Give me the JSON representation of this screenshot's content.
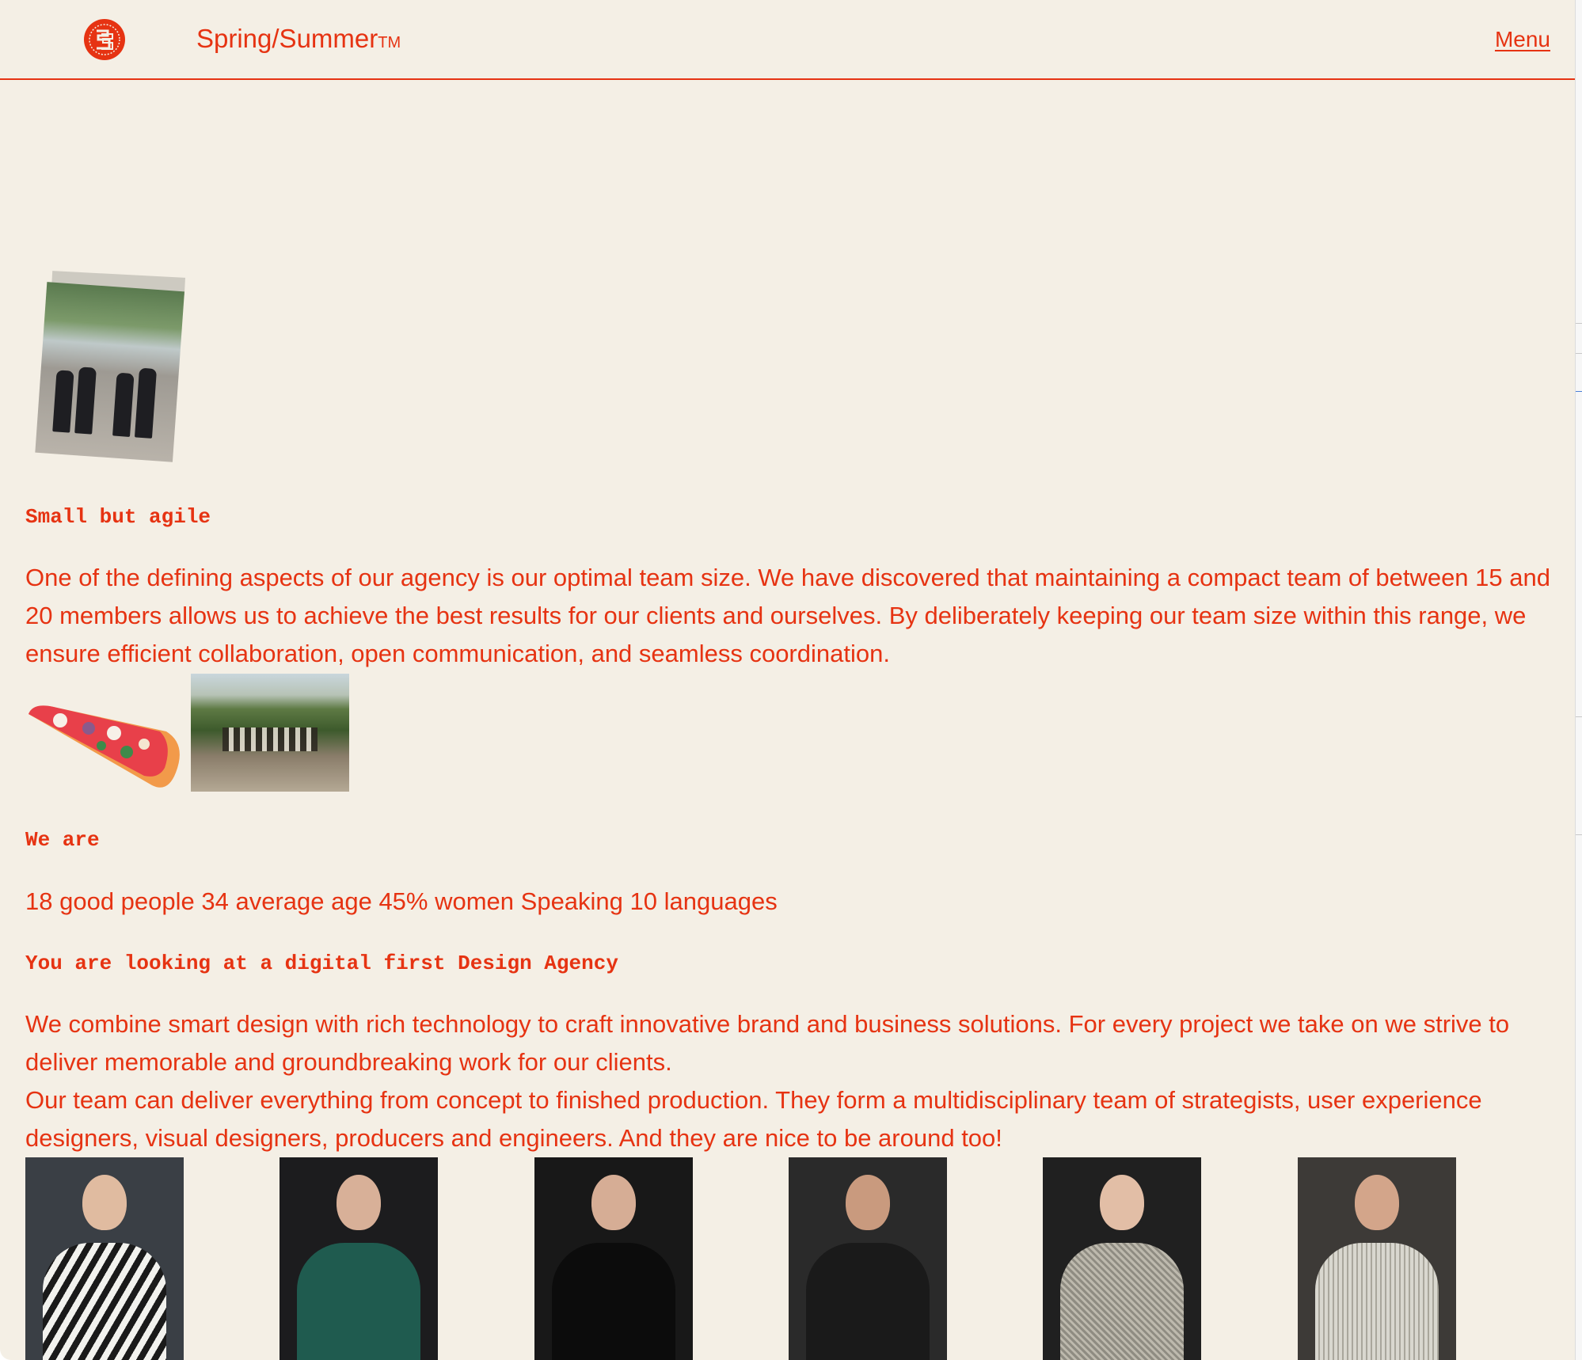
{
  "header": {
    "brand": "Spring/Summer",
    "brand_tm": "TM",
    "menu_label": "Menu"
  },
  "section_team_size": {
    "heading": "Small but agile",
    "body": "One of the defining aspects of our agency is our optimal team size. We have discovered that maintaining a compact team of between 15 and 20 members allows us to achieve the best results for our clients and ourselves. By deliberately keeping our team size within this range, we ensure efficient collaboration, open communication, and seamless coordination."
  },
  "section_we_are": {
    "heading": "We are",
    "body": "18 good people 34 average age 45% women Speaking 10 languages"
  },
  "section_agency": {
    "heading": "You are looking at a digital first Design Agency",
    "body_1": "We combine smart design with rich technology to craft innovative brand and business solutions. For every project we take on we strive to deliver memorable and groundbreaking work for our clients.",
    "body_2": "Our team can deliver everything from concept to finished production. They form a multidisciplinary team of strategists, user experience designers, visual designers, producers and engineers. And they are nice to be around too!"
  },
  "colors": {
    "accent": "#e63312",
    "background": "#f4efe5"
  },
  "team_portraits": [
    {
      "shirt": "#f2f2ee"
    },
    {
      "shirt": "#1f5b4f"
    },
    {
      "shirt": "#111111"
    },
    {
      "shirt": "#1a1a1a"
    },
    {
      "shirt": "#8f8c82"
    },
    {
      "shirt": "#d9d7cf"
    }
  ]
}
